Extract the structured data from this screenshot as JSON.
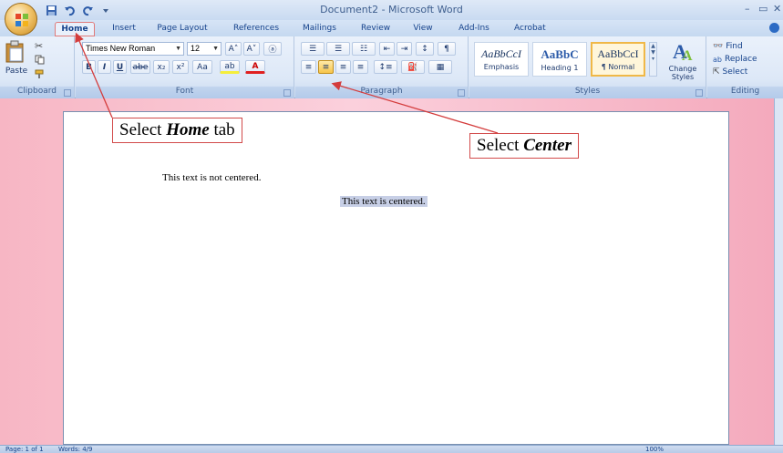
{
  "window": {
    "title": "Document2 - Microsoft Word",
    "minimize": "–",
    "maximize": "▭",
    "close": "✕"
  },
  "tabs": [
    "Home",
    "Insert",
    "Page Layout",
    "References",
    "Mailings",
    "Review",
    "View",
    "Add-Ins",
    "Acrobat"
  ],
  "ribbon": {
    "clipboard": {
      "paste": "Paste",
      "label": "Clipboard"
    },
    "font": {
      "family": "Times New Roman",
      "size": "12",
      "label": "Font",
      "bold": "B",
      "italic": "I",
      "underline": "U",
      "strike": "abe",
      "subscript": "x₂",
      "superscript": "x²",
      "case": "Aa",
      "highlight": "ab",
      "color": "A"
    },
    "paragraph": {
      "label": "Paragraph"
    },
    "styles": {
      "label": "Styles",
      "cards": [
        {
          "sample": "AaBbCcI",
          "name": "Emphasis"
        },
        {
          "sample": "AaBbC",
          "name": "Heading 1"
        },
        {
          "sample": "AaBbCcI",
          "name": "¶ Normal"
        }
      ],
      "change_styles": "Change Styles"
    },
    "editing": {
      "label": "Editing",
      "find": "Find",
      "replace": "Replace",
      "select": "Select"
    }
  },
  "document": {
    "line_left": "This text is not centered.",
    "line_centered": "This text is centered."
  },
  "callouts": {
    "home_prefix": "Select ",
    "home_em": "Home",
    "home_suffix": " tab",
    "center_prefix": "Select ",
    "center_em": "Center"
  },
  "status": {
    "page": "Page: 1 of 1",
    "words": "Words: 4/9",
    "zoom": "100%"
  },
  "colors": {
    "callout_border": "#d24a4a",
    "arrow": "#d43c3c",
    "ribbon": "#dde8f7",
    "selection": "#c7cfe6"
  }
}
